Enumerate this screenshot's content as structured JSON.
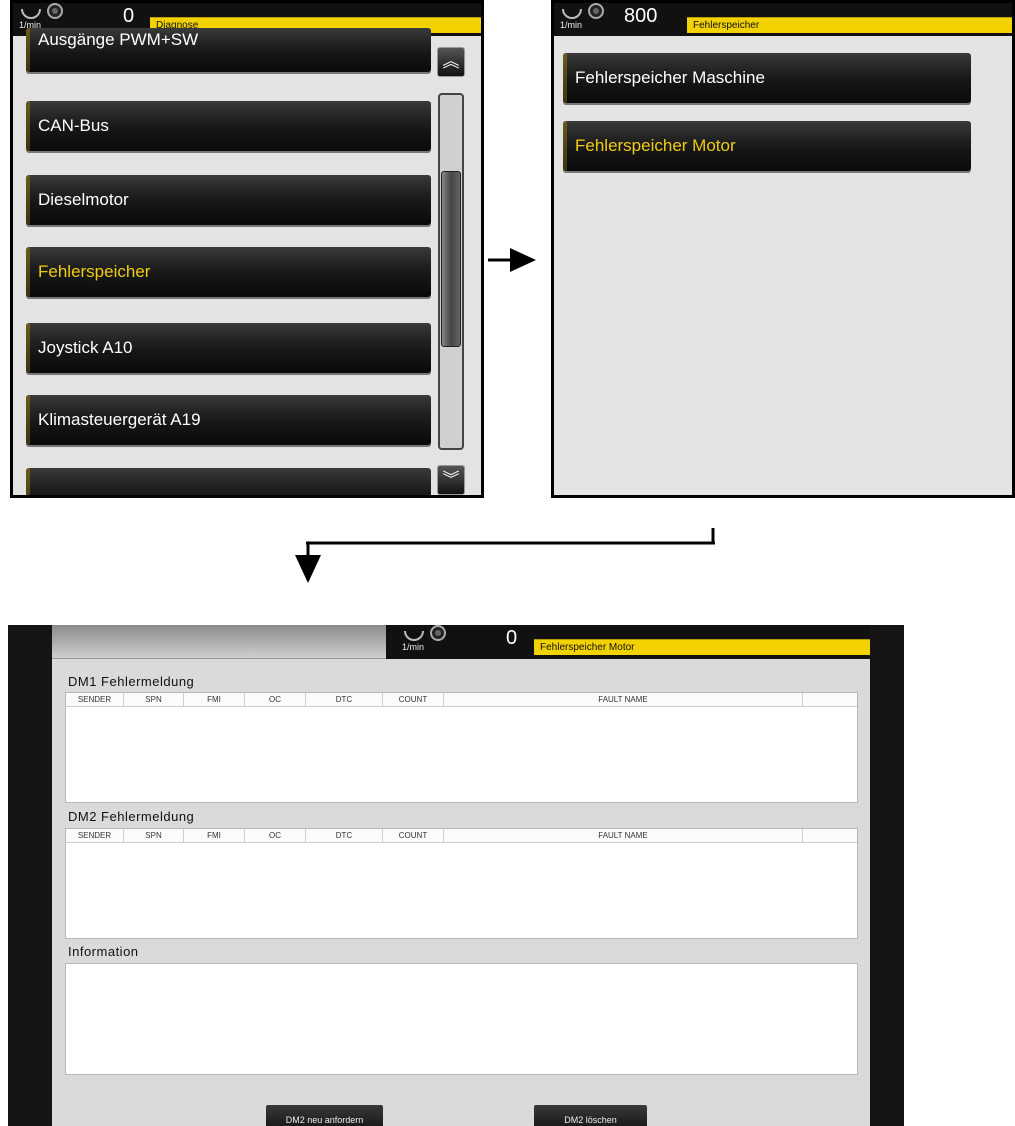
{
  "screen1": {
    "rpm": "0",
    "rpm_unit": "1/min",
    "title": "Diagnose",
    "menu_items": [
      {
        "label": "Ausgänge PWM+SW",
        "active": false
      },
      {
        "label": "CAN-Bus",
        "active": false
      },
      {
        "label": "Dieselmotor",
        "active": false
      },
      {
        "label": "Fehlerspeicher",
        "active": true
      },
      {
        "label": "Joystick A10",
        "active": false
      },
      {
        "label": "Klimasteuergerät A19",
        "active": false
      },
      {
        "label": "",
        "active": false
      }
    ],
    "scroll_up_icon": "double-chevron-up-icon",
    "scroll_down_icon": "double-chevron-down-icon"
  },
  "screen2": {
    "rpm": "800",
    "rpm_unit": "1/min",
    "title": "Fehlerspeicher",
    "menu_items": [
      {
        "label": "Fehlerspeicher Maschine",
        "active": false
      },
      {
        "label": "Fehlerspeicher Motor",
        "active": true
      }
    ]
  },
  "screen3": {
    "rpm": "0",
    "rpm_unit": "1/min",
    "title": "Fehlerspeicher Motor",
    "dm1_label": "DM1 Fehlermeldung",
    "dm2_label": "DM2 Fehlermeldung",
    "info_label": "Information",
    "columns": [
      "SENDER",
      "SPN",
      "FMI",
      "OC",
      "DTC",
      "COUNT",
      "FAULT NAME"
    ],
    "btn_request": "DM2 neu anfordern",
    "btn_delete": "DM2 löschen"
  },
  "colors": {
    "accent_yellow": "#f2d200",
    "active_text": "#f0cc10",
    "button_dark": "#151515",
    "panel_bg": "#e3e3e3"
  }
}
